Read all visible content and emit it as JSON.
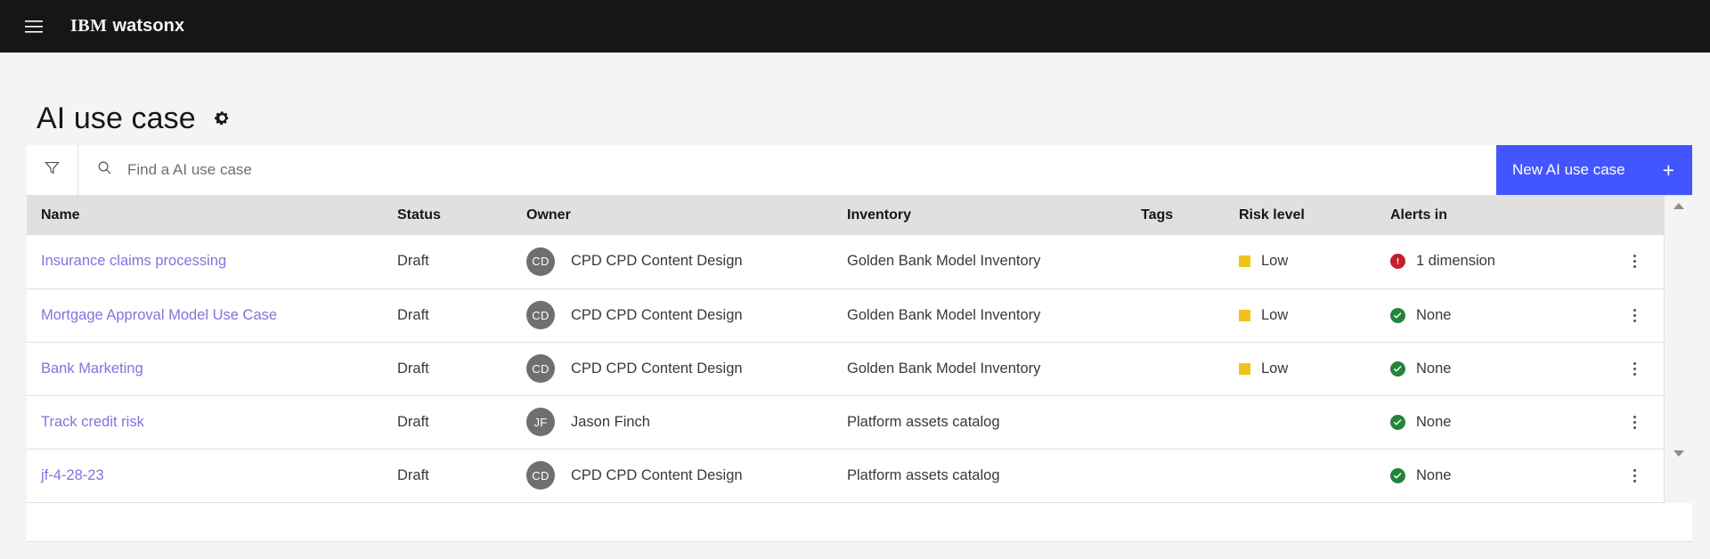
{
  "header": {
    "menu_icon": "hamburger-menu-icon",
    "brand_ibm": "IBM",
    "brand_product": "watsonx"
  },
  "page": {
    "title": "AI use case",
    "settings_icon": "gear-icon"
  },
  "toolbar": {
    "filter_icon": "filter-funnel-icon",
    "search_icon": "search-icon",
    "search_value": "",
    "search_placeholder": "Find a AI use case",
    "new_button_label": "New AI use case",
    "new_button_icon": "plus-icon",
    "new_button_color": "#4255ff"
  },
  "table": {
    "columns": [
      {
        "key": "name",
        "label": "Name"
      },
      {
        "key": "status",
        "label": "Status"
      },
      {
        "key": "owner",
        "label": "Owner"
      },
      {
        "key": "inventory",
        "label": "Inventory"
      },
      {
        "key": "tags",
        "label": "Tags"
      },
      {
        "key": "risk",
        "label": "Risk level"
      },
      {
        "key": "alerts",
        "label": "Alerts in"
      },
      {
        "key": "menu",
        "label": ""
      }
    ],
    "rows": [
      {
        "name": "Insurance claims processing",
        "status": "Draft",
        "owner_initials": "CD",
        "owner_name": "CPD CPD Content Design",
        "inventory": "Golden Bank Model Inventory",
        "tags": "",
        "risk": "Low",
        "risk_color": "#f1c21b",
        "alerts": "1 dimension",
        "alerts_state": "danger",
        "alerts_icon": "error-filled-icon",
        "menu_icon": "overflow-menu-icon"
      },
      {
        "name": "Mortgage Approval Model Use Case",
        "status": "Draft",
        "owner_initials": "CD",
        "owner_name": "CPD CPD Content Design",
        "inventory": "Golden Bank Model Inventory",
        "tags": "",
        "risk": "Low",
        "risk_color": "#f1c21b",
        "alerts": "None",
        "alerts_state": "ok",
        "alerts_icon": "checkmark-filled-icon",
        "menu_icon": "overflow-menu-icon"
      },
      {
        "name": "Bank Marketing",
        "status": "Draft",
        "owner_initials": "CD",
        "owner_name": "CPD CPD Content Design",
        "inventory": "Golden Bank Model Inventory",
        "tags": "",
        "risk": "Low",
        "risk_color": "#f1c21b",
        "alerts": "None",
        "alerts_state": "ok",
        "alerts_icon": "checkmark-filled-icon",
        "menu_icon": "overflow-menu-icon"
      },
      {
        "name": "Track credit risk",
        "status": "Draft",
        "owner_initials": "JF",
        "owner_name": "Jason Finch",
        "inventory": "Platform assets catalog",
        "tags": "",
        "risk": "",
        "risk_color": "",
        "alerts": "None",
        "alerts_state": "ok",
        "alerts_icon": "checkmark-filled-icon",
        "menu_icon": "overflow-menu-icon"
      },
      {
        "name": "jf-4-28-23",
        "status": "Draft",
        "owner_initials": "CD",
        "owner_name": "CPD CPD Content Design",
        "inventory": "Platform assets catalog",
        "tags": "",
        "risk": "",
        "risk_color": "",
        "alerts": "None",
        "alerts_state": "ok",
        "alerts_icon": "checkmark-filled-icon",
        "menu_icon": "overflow-menu-icon"
      }
    ],
    "scrollbar": {
      "up_icon": "scroll-up-arrow-icon",
      "down_icon": "scroll-down-arrow-icon"
    }
  }
}
